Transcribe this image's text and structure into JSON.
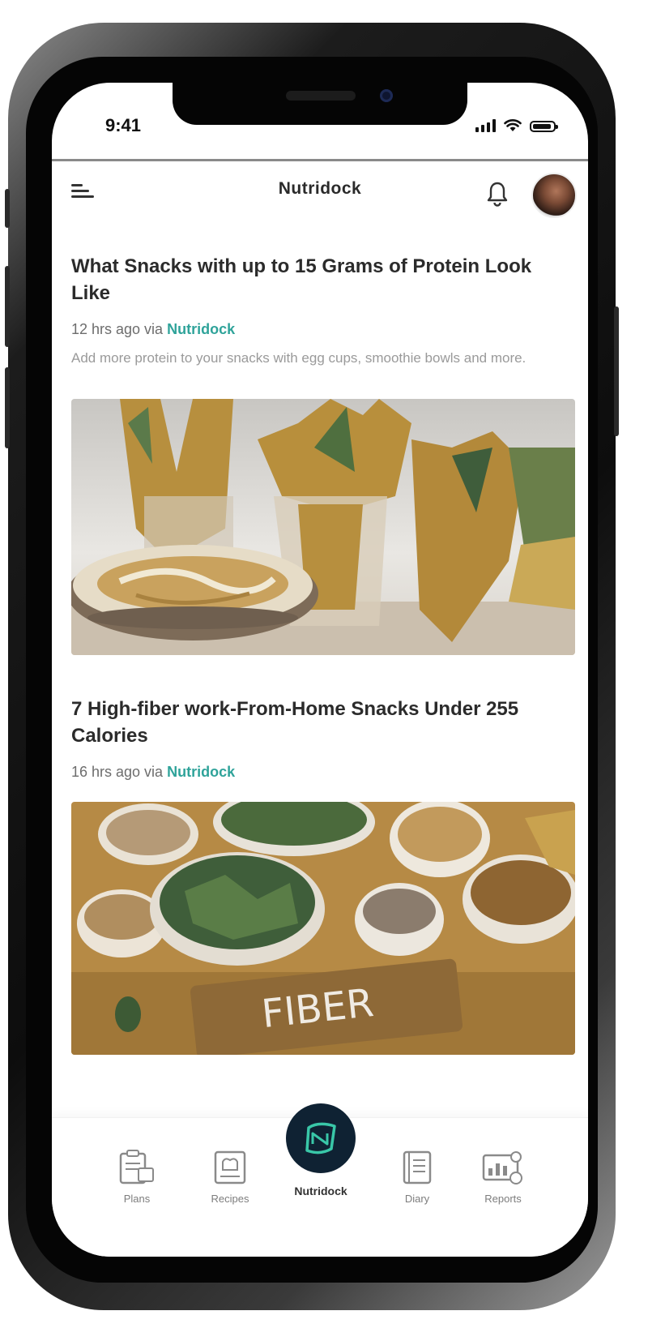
{
  "status_bar": {
    "time": "9:41"
  },
  "header": {
    "title": "Nutridock"
  },
  "articles": [
    {
      "title": "What Snacks with up to 15 Grams of Protein Look Like",
      "time": "12 hrs ago via",
      "source": "Nutridock",
      "summary": "Add more protein to your snacks with egg cups, smoothie bowls and more.",
      "image": "protein-snacks-photo"
    },
    {
      "title": "7 High-fiber work-From-Home Snacks Under 255 Calories",
      "time": "16 hrs ago via",
      "source": "Nutridock",
      "image": "fiber-foods-photo",
      "image_text": "FIBER"
    }
  ],
  "bottom_nav": {
    "items": [
      {
        "label": "Plans",
        "icon": "plans-icon"
      },
      {
        "label": "Recipes",
        "icon": "recipes-icon"
      },
      {
        "label": "Nutridock",
        "icon": "nutridock-logo-icon",
        "active": true
      },
      {
        "label": "Diary",
        "icon": "diary-icon"
      },
      {
        "label": "Reports",
        "icon": "reports-icon"
      }
    ]
  },
  "colors": {
    "accent": "#2fa39a",
    "nav_center": "#0f2233",
    "logo": "#39c7a8"
  }
}
